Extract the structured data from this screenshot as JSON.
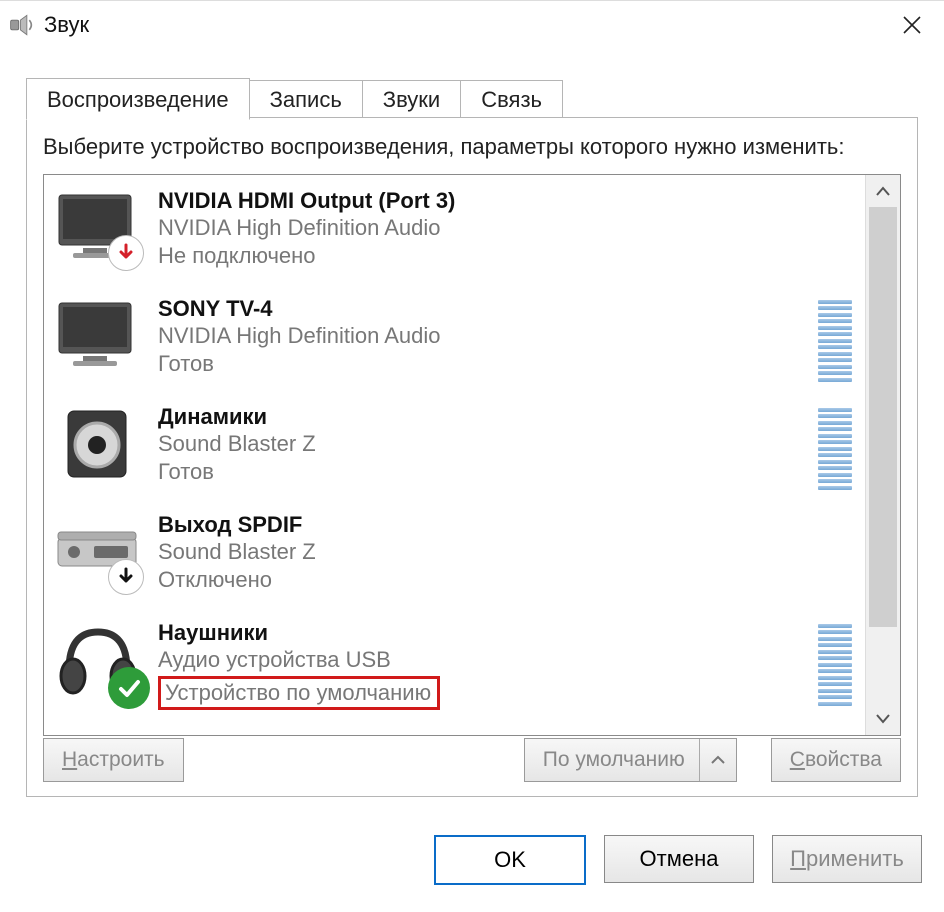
{
  "window": {
    "title": "Звук",
    "close_icon": "close"
  },
  "tabs": [
    {
      "label": "Воспроизведение",
      "active": true
    },
    {
      "label": "Запись",
      "active": false
    },
    {
      "label": "Звуки",
      "active": false
    },
    {
      "label": "Связь",
      "active": false
    }
  ],
  "instruction": "Выберите устройство воспроизведения, параметры которого нужно изменить:",
  "devices": [
    {
      "icon": "monitor",
      "badge": "red-down",
      "name": "NVIDIA HDMI Output (Port 3)",
      "subtitle": "NVIDIA High Definition Audio",
      "status": "Не подключено",
      "meter": false,
      "highlight": false
    },
    {
      "icon": "monitor",
      "badge": null,
      "name": "SONY TV-4",
      "subtitle": "NVIDIA High Definition Audio",
      "status": "Готов",
      "meter": true,
      "highlight": false
    },
    {
      "icon": "speaker",
      "badge": null,
      "name": "Динамики",
      "subtitle": "Sound Blaster Z",
      "status": "Готов",
      "meter": true,
      "highlight": false
    },
    {
      "icon": "receiver",
      "badge": "black-down",
      "name": "Выход SPDIF",
      "subtitle": "Sound Blaster Z",
      "status": "Отключено",
      "meter": false,
      "highlight": false
    },
    {
      "icon": "headphones",
      "badge": "green-check",
      "name": "Наушники",
      "subtitle": "Аудио устройства USB",
      "status": "Устройство по умолчанию",
      "meter": true,
      "highlight": true
    }
  ],
  "panel_buttons": {
    "configure": "Настроить",
    "set_default": "По умолчанию",
    "properties": "Свойства"
  },
  "dialog_buttons": {
    "ok": "OK",
    "cancel": "Отмена",
    "apply": "Применить"
  }
}
